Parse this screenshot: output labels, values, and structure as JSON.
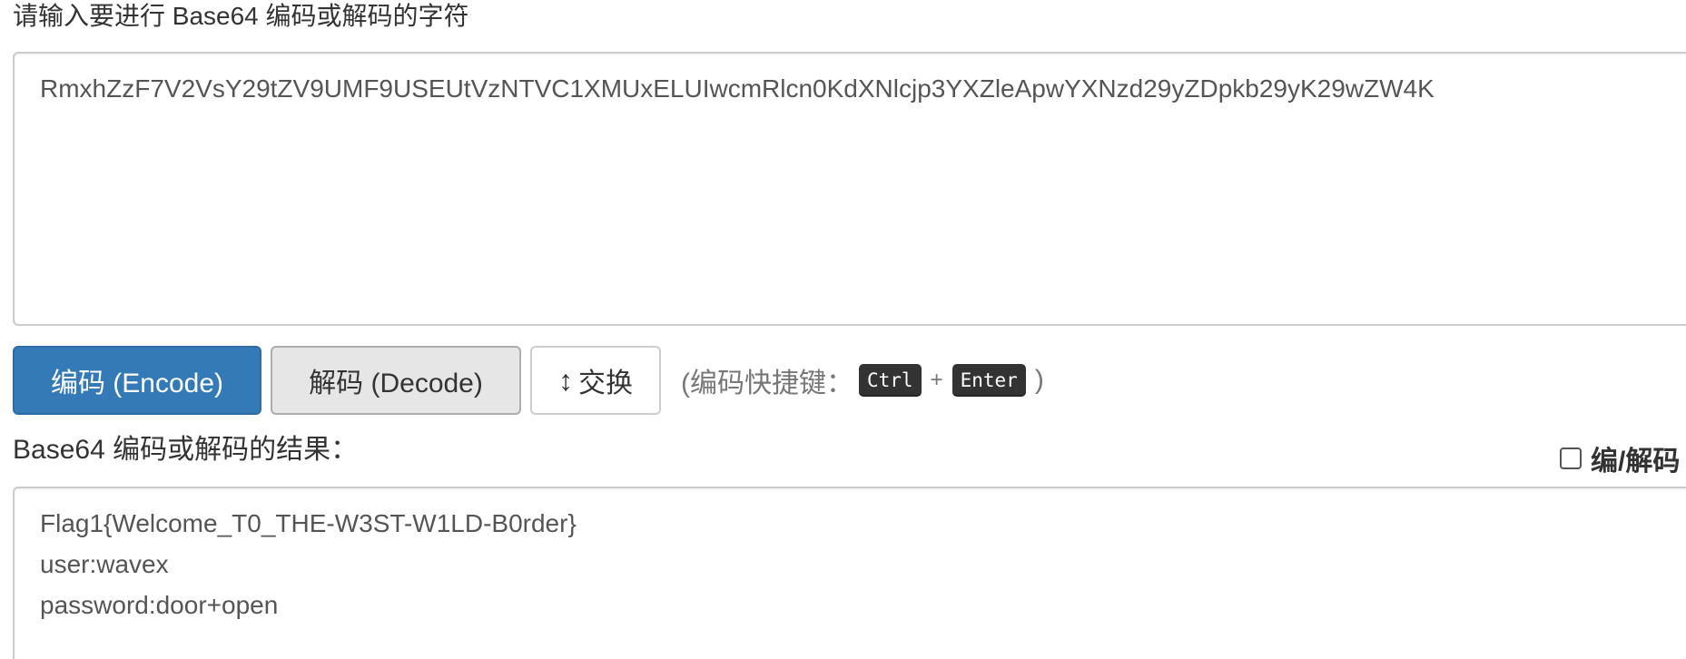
{
  "input_section": {
    "label": "请输入要进行 Base64 编码或解码的字符",
    "value": "RmxhZzF7V2VsY29tZV9UMF9USEUtVzNTVC1XMUxELUIwcmRlcn0KdXNlcjp3YXZleApwYXNzd29yZDpkb29yK29wZW4K"
  },
  "buttons": {
    "encode": "编码 (Encode)",
    "decode": "解码 (Decode)",
    "swap_icon": "↕",
    "swap": "交换"
  },
  "shortcut": {
    "prefix": "(编码快捷键：",
    "key1": "Ctrl",
    "plus": "+",
    "key2": "Enter",
    "suffix": ")"
  },
  "result_section": {
    "label": "Base64 编码或解码的结果：",
    "toggle_label": "编/解码",
    "lines": [
      "Flag1{Welcome_T0_THE-W3ST-W1LD-B0rder}",
      "user:wavex",
      "password:door+open"
    ]
  },
  "colors": {
    "primary": "#337ab7",
    "default_active": "#e6e6e6",
    "kbd_bg": "#333333"
  }
}
